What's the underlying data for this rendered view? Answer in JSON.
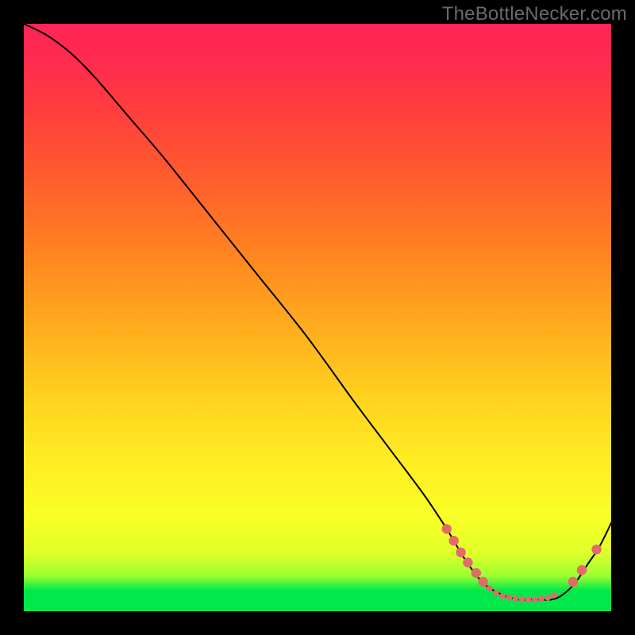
{
  "watermark": "TheBottleNecker.com",
  "chart_data": {
    "type": "line",
    "title": "",
    "xlabel": "",
    "ylabel": "",
    "xlim": [
      0,
      100
    ],
    "ylim": [
      0,
      100
    ],
    "note": "No numeric axis ticks or labels are rendered; values are normalized 0–100. The curve descends from top-left, reaches a flat minimum near x≈78–90, then rises toward the right edge. Salmon dots mark the region around the minimum.",
    "series": [
      {
        "name": "curve",
        "x": [
          0,
          4,
          8,
          12,
          18,
          24,
          32,
          40,
          48,
          56,
          62,
          68,
          72,
          75,
          78,
          81,
          84,
          87,
          90,
          92,
          94,
          96,
          98,
          100
        ],
        "y": [
          100,
          98,
          95,
          91,
          84,
          77,
          67,
          57,
          47,
          36,
          28,
          20,
          14,
          9,
          5,
          3,
          2,
          2,
          2,
          3,
          5,
          8,
          11,
          15
        ]
      }
    ],
    "markers": {
      "name": "highlight-dots",
      "color": "#e46a6a",
      "radius_small": 3.8,
      "radius_large": 6.2,
      "points": [
        {
          "x": 72.0,
          "y": 14.0,
          "r": "large"
        },
        {
          "x": 73.2,
          "y": 12.0,
          "r": "large"
        },
        {
          "x": 74.4,
          "y": 10.0,
          "r": "large"
        },
        {
          "x": 75.6,
          "y": 8.3,
          "r": "large"
        },
        {
          "x": 77.0,
          "y": 6.5,
          "r": "large"
        },
        {
          "x": 78.2,
          "y": 5.0,
          "r": "large"
        },
        {
          "x": 79.3,
          "y": 3.9,
          "r": "small"
        },
        {
          "x": 80.4,
          "y": 3.1,
          "r": "small"
        },
        {
          "x": 81.5,
          "y": 2.6,
          "r": "small"
        },
        {
          "x": 82.6,
          "y": 2.3,
          "r": "small"
        },
        {
          "x": 83.7,
          "y": 2.1,
          "r": "small"
        },
        {
          "x": 84.8,
          "y": 2.0,
          "r": "small"
        },
        {
          "x": 85.9,
          "y": 2.0,
          "r": "small"
        },
        {
          "x": 87.0,
          "y": 2.0,
          "r": "small"
        },
        {
          "x": 88.1,
          "y": 2.1,
          "r": "small"
        },
        {
          "x": 89.2,
          "y": 2.3,
          "r": "small"
        },
        {
          "x": 90.3,
          "y": 2.7,
          "r": "small"
        },
        {
          "x": 93.5,
          "y": 5.0,
          "r": "large"
        },
        {
          "x": 95.0,
          "y": 7.0,
          "r": "large"
        },
        {
          "x": 97.5,
          "y": 10.5,
          "r": "large"
        }
      ]
    }
  }
}
